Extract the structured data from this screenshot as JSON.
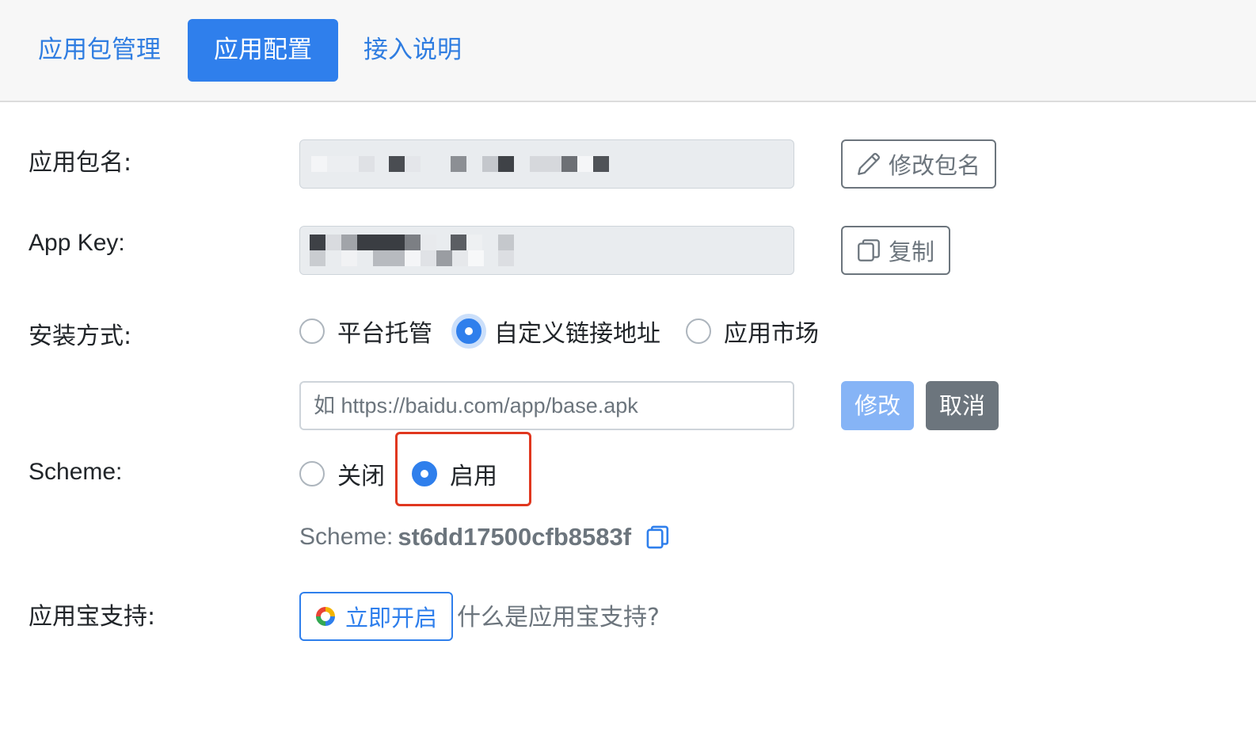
{
  "tabs": [
    {
      "label": "应用包管理",
      "active": false
    },
    {
      "label": "应用配置",
      "active": true
    },
    {
      "label": "接入说明",
      "active": false
    }
  ],
  "form": {
    "package_name": {
      "label": "应用包名:",
      "value_obscured": true,
      "edit_button": "修改包名",
      "edit_icon": "pencil-icon"
    },
    "app_key": {
      "label": "App Key:",
      "value_obscured": true,
      "copy_button": "复制",
      "copy_icon": "copy-icon"
    },
    "install_method": {
      "label": "安装方式:",
      "options": [
        {
          "label": "平台托管",
          "checked": false
        },
        {
          "label": "自定义链接地址",
          "checked": true
        },
        {
          "label": "应用市场",
          "checked": false
        }
      ],
      "url_placeholder": "如 https://baidu.com/app/base.apk",
      "save_button": "修改",
      "cancel_button": "取消"
    },
    "scheme": {
      "label": "Scheme:",
      "options": [
        {
          "label": "关闭",
          "checked": false
        },
        {
          "label": "启用",
          "checked": true
        }
      ],
      "prefix": "Scheme:",
      "value": "st6dd17500cfb8583f",
      "copy_icon": "copy-icon"
    },
    "yyb_support": {
      "label": "应用宝支持:",
      "enable_button": "立即开启",
      "enable_icon": "yyb-logo-icon",
      "help_link": "什么是应用宝支持?"
    }
  },
  "colors": {
    "primary": "#2f7fec",
    "primary_light": "#86b4f6",
    "secondary": "#6c757d",
    "highlight": "#e0371f",
    "field_bg": "#e9ecef"
  }
}
